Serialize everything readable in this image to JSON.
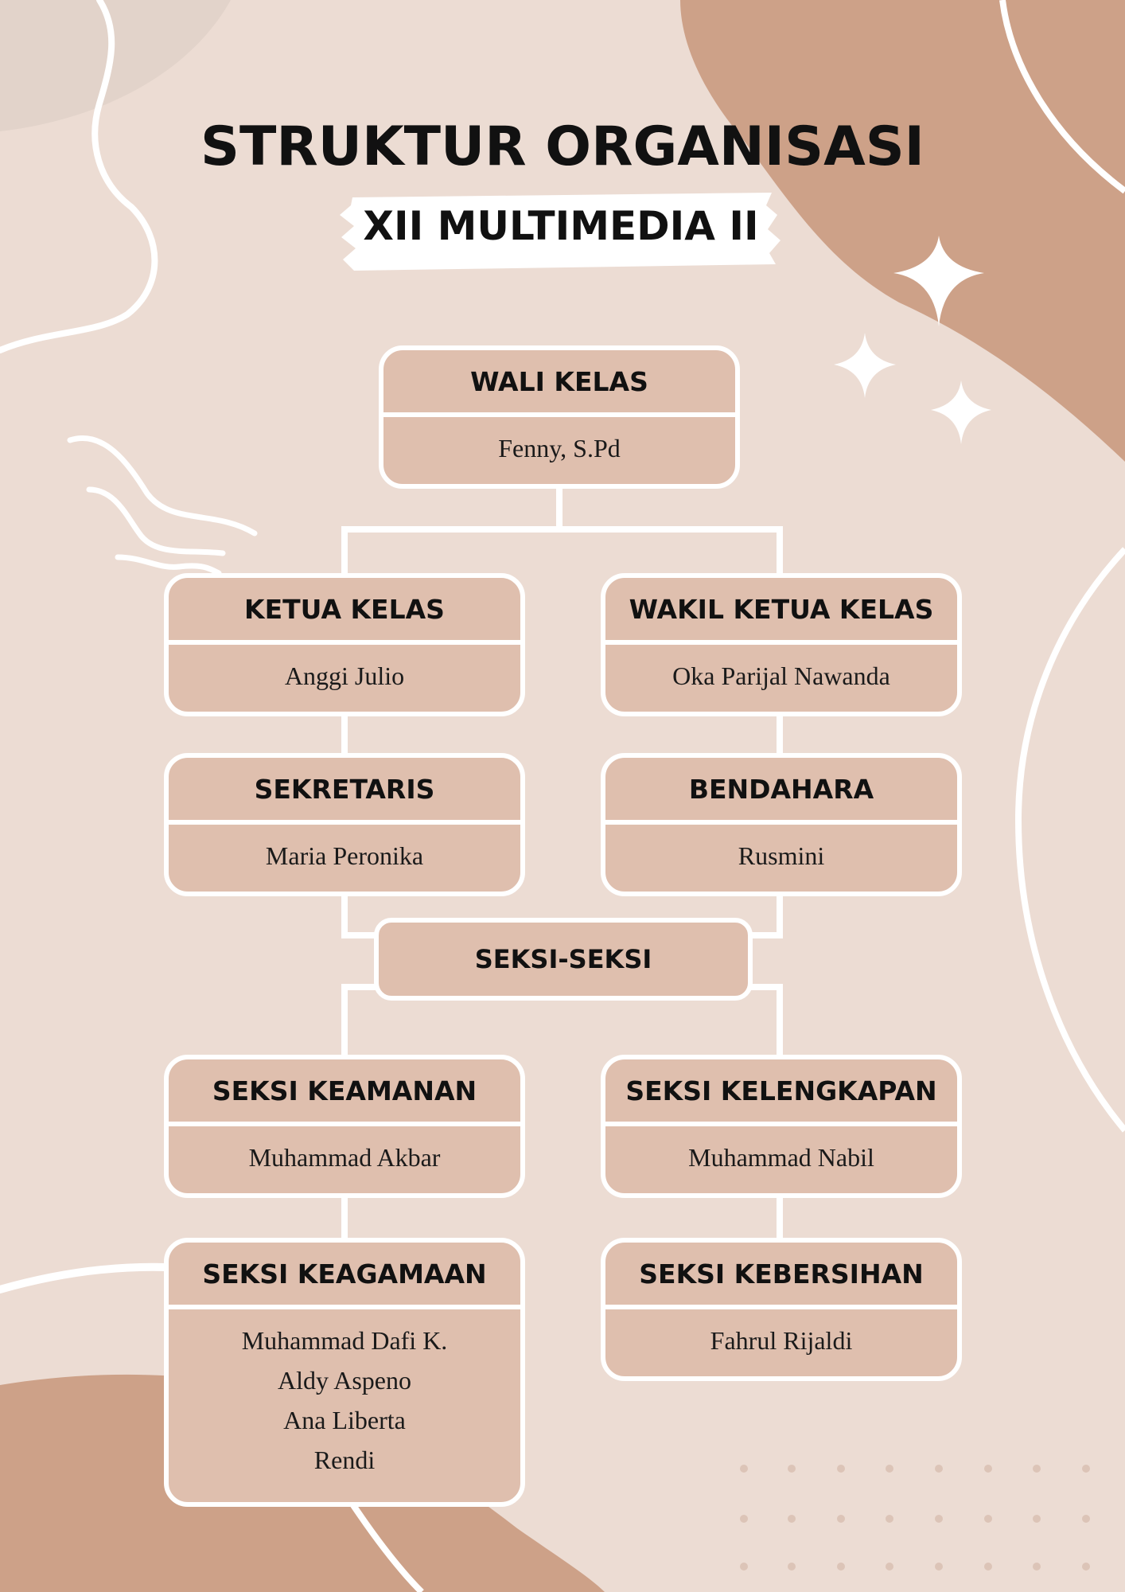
{
  "header": {
    "title": "STRUKTUR ORGANISASI",
    "subtitle": "XII MULTIMEDIA II"
  },
  "chart": {
    "wali_kelas": {
      "role": "WALI KELAS",
      "name": "Fenny, S.Pd"
    },
    "ketua_kelas": {
      "role": "KETUA KELAS",
      "name": "Anggi Julio"
    },
    "wakil_ketua_kelas": {
      "role": "WAKIL KETUA KELAS",
      "name": "Oka Parijal Nawanda"
    },
    "sekretaris": {
      "role": "SEKRETARIS",
      "name": "Maria Peronika"
    },
    "bendahara": {
      "role": "BENDAHARA",
      "name": "Rusmini"
    },
    "seksi_seksi": {
      "label": "SEKSI-SEKSI"
    },
    "seksi_keamanan": {
      "role": "SEKSI KEAMANAN",
      "name": "Muhammad Akbar"
    },
    "seksi_kelengkapan": {
      "role": "SEKSI KELENGKAPAN",
      "name": "Muhammad Nabil"
    },
    "seksi_keagamaan": {
      "role": "SEKSI KEAGAMAAN",
      "names": [
        "Muhammad Dafi K.",
        "Aldy Aspeno",
        "Ana Liberta",
        "Rendi"
      ]
    },
    "seksi_kebersihan": {
      "role": "SEKSI KEBERSIHAN",
      "name": "Fahrul Rijaldi"
    }
  },
  "colors": {
    "background": "#ecdcd3",
    "accent_shape": "#cda188",
    "box_fill": "#dfbfae",
    "line": "#ffffff"
  },
  "icons": [
    "sparkle-icon",
    "sparkle-icon",
    "sparkle-icon"
  ]
}
